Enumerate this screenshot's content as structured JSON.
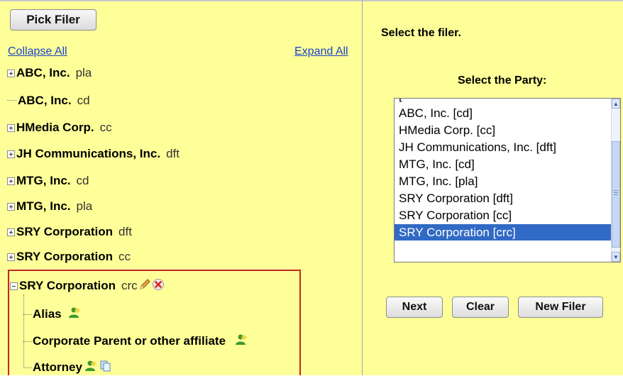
{
  "left": {
    "pick_filer": "Pick Filer",
    "collapse_all": "Collapse All",
    "expand_all": "Expand All",
    "tree": [
      {
        "name": "ABC, Inc.",
        "role": "pla",
        "expander": "plus"
      },
      {
        "name": "ABC, Inc.",
        "role": "cd",
        "expander": "none"
      },
      {
        "name": "HMedia Corp.",
        "role": "cc",
        "expander": "plus"
      },
      {
        "name": "JH Communications, Inc.",
        "role": "dft",
        "expander": "plus"
      },
      {
        "name": "MTG, Inc.",
        "role": "cd",
        "expander": "plus"
      },
      {
        "name": "MTG, Inc.",
        "role": "pla",
        "expander": "plus"
      },
      {
        "name": "SRY Corporation",
        "role": "dft",
        "expander": "plus"
      },
      {
        "name": "SRY Corporation",
        "role": "cc",
        "expander": "plus"
      },
      {
        "name": "SRY Corporation",
        "role": "crc",
        "expander": "minus"
      }
    ],
    "children": [
      {
        "label": "Alias",
        "icons": [
          "add-person-icon"
        ]
      },
      {
        "label": "Corporate Parent or other affiliate",
        "icons": [
          "add-person-icon"
        ]
      },
      {
        "label": "Attorney",
        "icons": [
          "add-person-icon",
          "copy-icon"
        ]
      }
    ]
  },
  "right": {
    "title": "Select the filer.",
    "party_label": "Select the Party:",
    "party_list": [
      "ABC, Inc. [cd]",
      "HMedia Corp. [cc]",
      "JH Communications, Inc. [dft]",
      "MTG, Inc. [cd]",
      "MTG, Inc. [pla]",
      "SRY Corporation [dft]",
      "SRY Corporation [cc]",
      "SRY Corporation [crc]"
    ],
    "selected_party": "SRY Corporation [crc]",
    "buttons": {
      "next": "Next",
      "clear": "Clear",
      "new_filer": "New Filer"
    }
  },
  "colors": {
    "panel_bg": "#ffff99",
    "selection": "#316ac5",
    "highlight_border": "#c0282a",
    "link": "#1a44c8"
  }
}
